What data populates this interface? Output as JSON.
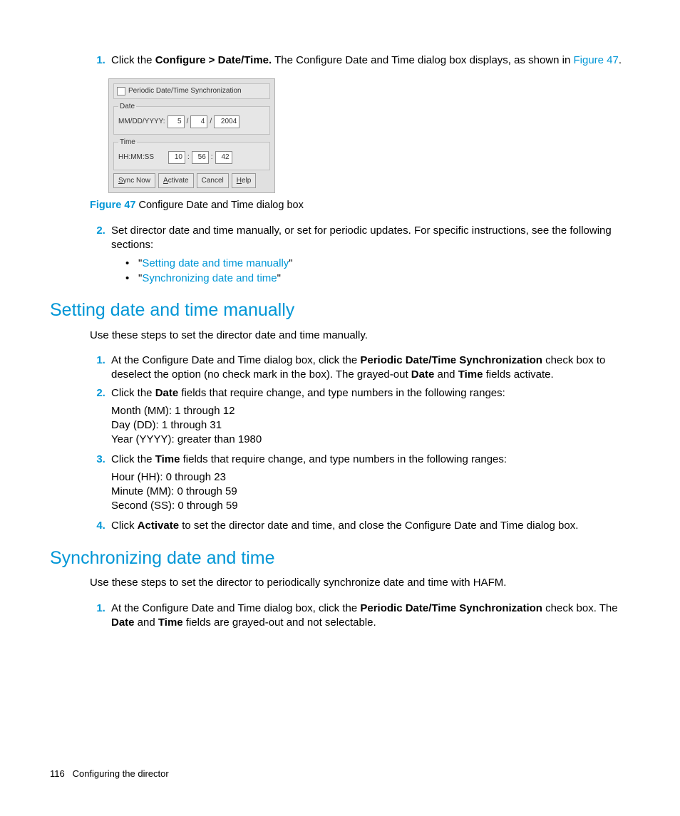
{
  "step1": {
    "pre": "Click the ",
    "bold": "Configure > Date/Time.",
    "post1": " The Configure Date and Time dialog box displays, as shown in ",
    "link": "Figure 47",
    "post2": "."
  },
  "dialog": {
    "sync_label": "Periodic Date/Time Synchronization",
    "date_legend": "Date",
    "date_prefix": "MM/DD/YYYY:",
    "mm": "5",
    "dd": "4",
    "yyyy": "2004",
    "time_legend": "Time",
    "time_prefix": "HH:MM:SS",
    "hh": "10",
    "mi": "56",
    "ss": "42",
    "btn_sync": "Sync Now",
    "btn_sync_u": "S",
    "btn_sync_rest": "ync Now",
    "btn_activate": "Activate",
    "btn_activate_u": "A",
    "btn_activate_rest": "ctivate",
    "btn_cancel": "Cancel",
    "btn_help": "Help",
    "btn_help_u": "H",
    "btn_help_rest": "elp"
  },
  "fig47": {
    "label": "Figure 47",
    "text": " Configure Date and Time dialog box"
  },
  "step2": {
    "text": "Set director date and time manually, or set for periodic updates. For specific instructions, see the following sections:",
    "b1_q1": "\"",
    "b1_link": "Setting date and time manually",
    "b1_q2": "\"",
    "b2_q1": "\"",
    "b2_link": "Synchronizing date and time",
    "b2_q2": "\""
  },
  "h_manual": "Setting date and time manually",
  "p_manual": "Use these steps to set the director date and time manually.",
  "m1": {
    "t1": "At the Configure Date and Time dialog box, click the ",
    "b1": "Periodic Date/Time Synchronization",
    "t2": " check box to deselect the option (no check mark in the box). The grayed-out ",
    "b2": "Date",
    "t3": " and ",
    "b3": "Time",
    "t4": " fields activate."
  },
  "m2": {
    "t1": "Click the ",
    "b1": "Date",
    "t2": " fields that require change, and type numbers in the following ranges:",
    "r1": "Month (MM): 1 through 12",
    "r2": "Day (DD): 1 through 31",
    "r3": "Year (YYYY): greater than 1980"
  },
  "m3": {
    "t1": "Click the ",
    "b1": "Time",
    "t2": " fields that require change, and type numbers in the following ranges:",
    "r1": "Hour (HH): 0 through 23",
    "r2": "Minute (MM): 0 through 59",
    "r3": "Second (SS): 0 through 59"
  },
  "m4": {
    "t1": "Click ",
    "b1": "Activate",
    "t2": " to set the director date and time, and close the Configure Date and Time dialog box."
  },
  "h_sync": "Synchronizing date and time",
  "p_sync": "Use these steps to set the director to periodically synchronize date and time with HAFM.",
  "s1": {
    "t1": "At the Configure Date and Time dialog box, click the ",
    "b1": "Periodic Date/Time Synchronization",
    "t2": " check box. The ",
    "b2": "Date",
    "t3": " and ",
    "b3": "Time",
    "t4": " fields are grayed-out and not selectable."
  },
  "footer": {
    "page": "116",
    "title": "Configuring the director"
  }
}
